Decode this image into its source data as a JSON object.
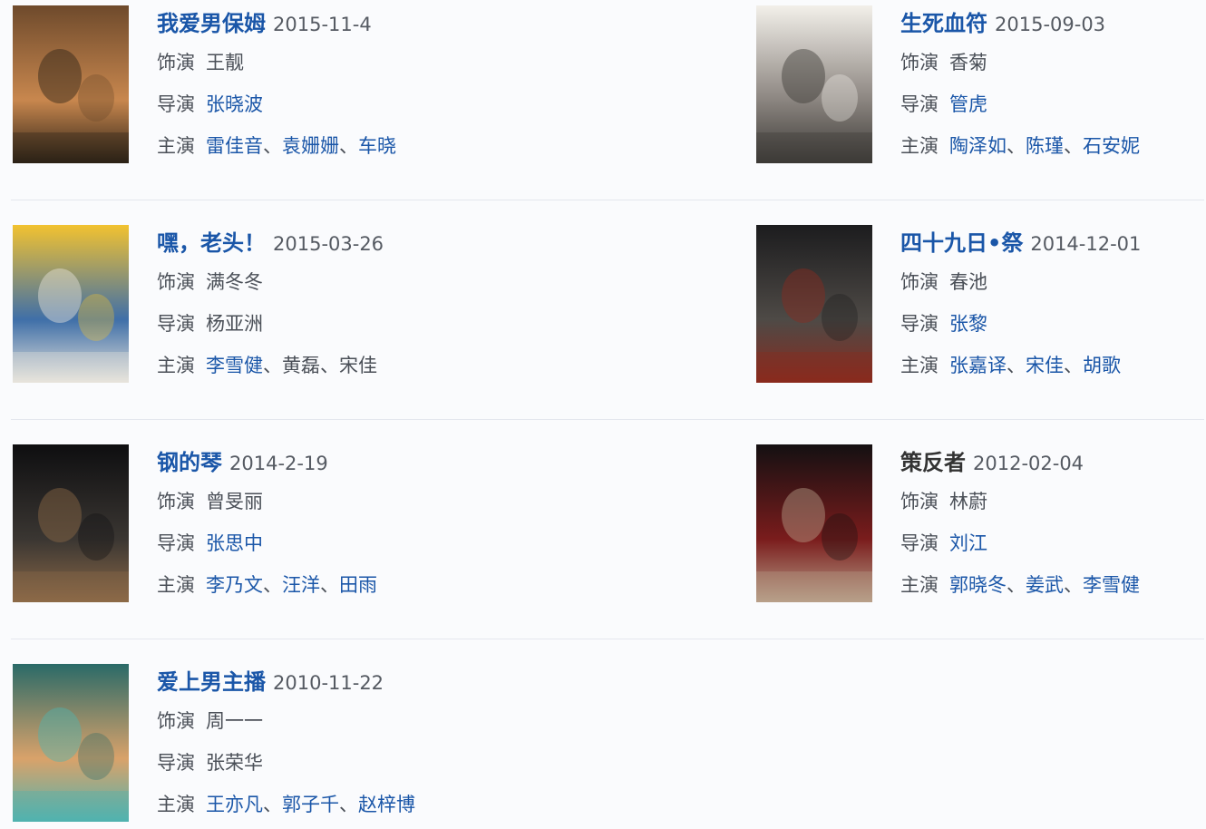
{
  "labels": {
    "role": "饰演",
    "director": "导演",
    "cast": "主演",
    "sep": "、"
  },
  "films": [
    {
      "title": "我爱男保姆",
      "title_link": true,
      "date": "2015-11-4",
      "role": "王靓",
      "director": "张晓波",
      "director_link": true,
      "cast": [
        {
          "name": "雷佳音",
          "link": true
        },
        {
          "name": "袁姗姗",
          "link": true
        },
        {
          "name": "车晓",
          "link": true
        }
      ],
      "poster_colors": [
        "#6e4a2c",
        "#c8874e",
        "#2b2116"
      ]
    },
    {
      "title": "生死血符",
      "title_link": true,
      "date": "2015-09-03",
      "role": "香菊",
      "director": "管虎",
      "director_link": true,
      "cast": [
        {
          "name": "陶泽如",
          "link": true
        },
        {
          "name": "陈瑾",
          "link": true
        },
        {
          "name": "石安妮",
          "link": true
        }
      ],
      "poster_colors": [
        "#f3f0ea",
        "#8b8580",
        "#3c3a36"
      ]
    },
    {
      "title": "嘿，老头！",
      "title_link": true,
      "date": "2015-03-26",
      "role": "满冬冬",
      "director": "杨亚洲",
      "director_link": false,
      "cast": [
        {
          "name": "李雪健",
          "link": true
        },
        {
          "name": "黄磊",
          "link": false
        },
        {
          "name": "宋佳",
          "link": false
        }
      ],
      "poster_colors": [
        "#f2c230",
        "#3f6fa8",
        "#e8e4dc"
      ]
    },
    {
      "title": "四十九日•祭",
      "title_link": true,
      "date": "2014-12-01",
      "role": "春池",
      "director": "张黎",
      "director_link": true,
      "cast": [
        {
          "name": "张嘉译",
          "link": true
        },
        {
          "name": "宋佳",
          "link": true
        },
        {
          "name": "胡歌",
          "link": true
        }
      ],
      "poster_colors": [
        "#1c1c1e",
        "#4e4a46",
        "#8a2a1e"
      ]
    },
    {
      "title": "钢的琴",
      "title_link": true,
      "date": "2014-2-19",
      "role": "曾旻丽",
      "director": "张思中",
      "director_link": true,
      "cast": [
        {
          "name": "李乃文",
          "link": true
        },
        {
          "name": "汪洋",
          "link": true
        },
        {
          "name": "田雨",
          "link": true
        }
      ],
      "poster_colors": [
        "#0e0e10",
        "#3a3632",
        "#8d6a48"
      ]
    },
    {
      "title": "策反者",
      "title_link": false,
      "date": "2012-02-04",
      "role": "林蔚",
      "director": "刘江",
      "director_link": true,
      "cast": [
        {
          "name": "郭晓冬",
          "link": true
        },
        {
          "name": "姜武",
          "link": true
        },
        {
          "name": "李雪健",
          "link": true
        }
      ],
      "poster_colors": [
        "#141012",
        "#7a1c1c",
        "#b8a08a"
      ]
    },
    {
      "title": "爱上男主播",
      "title_link": true,
      "date": "2010-11-22",
      "role": "周一一",
      "director": "张荣华",
      "director_link": false,
      "cast": [
        {
          "name": "王亦凡",
          "link": true
        },
        {
          "name": "郭子千",
          "link": true
        },
        {
          "name": "赵梓博",
          "link": true
        }
      ],
      "poster_colors": [
        "#2a6a68",
        "#d9a26a",
        "#4fb3b0"
      ]
    }
  ]
}
